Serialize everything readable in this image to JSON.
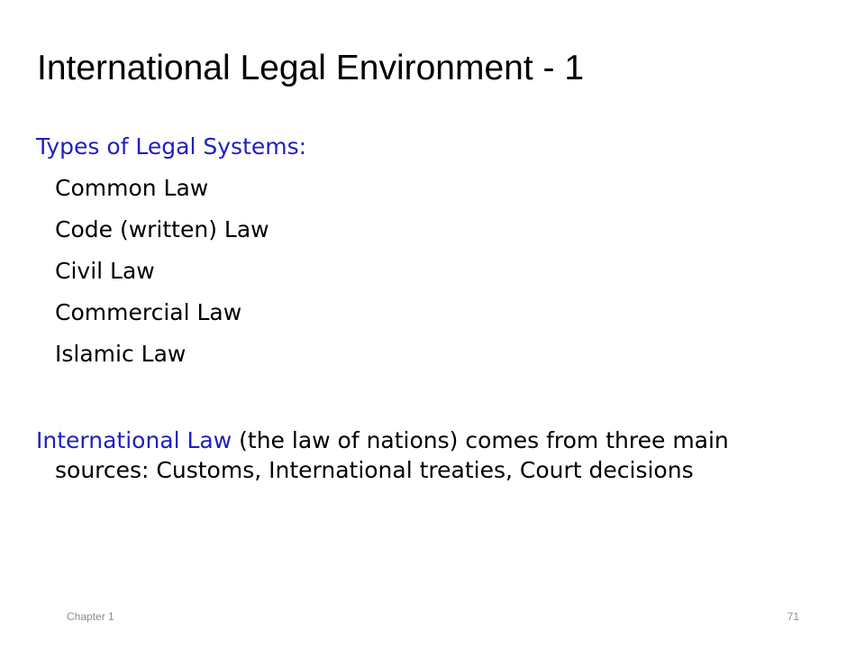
{
  "slide": {
    "title": "International Legal Environment - 1",
    "heading": "Types of Legal Systems:",
    "systems": [
      "Common Law",
      "Code (written) Law",
      "Civil Law",
      "Commercial Law",
      "Islamic Law"
    ],
    "paragraph": {
      "highlight": "International Law",
      "rest": " (the law of nations) comes from three main sources: Customs, International treaties, Court decisions"
    }
  },
  "footer": {
    "chapter": "Chapter 1",
    "page_number": "71"
  },
  "colors": {
    "accent": "#1f1fbf",
    "text": "#000000",
    "footer": "#8c8c8c"
  }
}
